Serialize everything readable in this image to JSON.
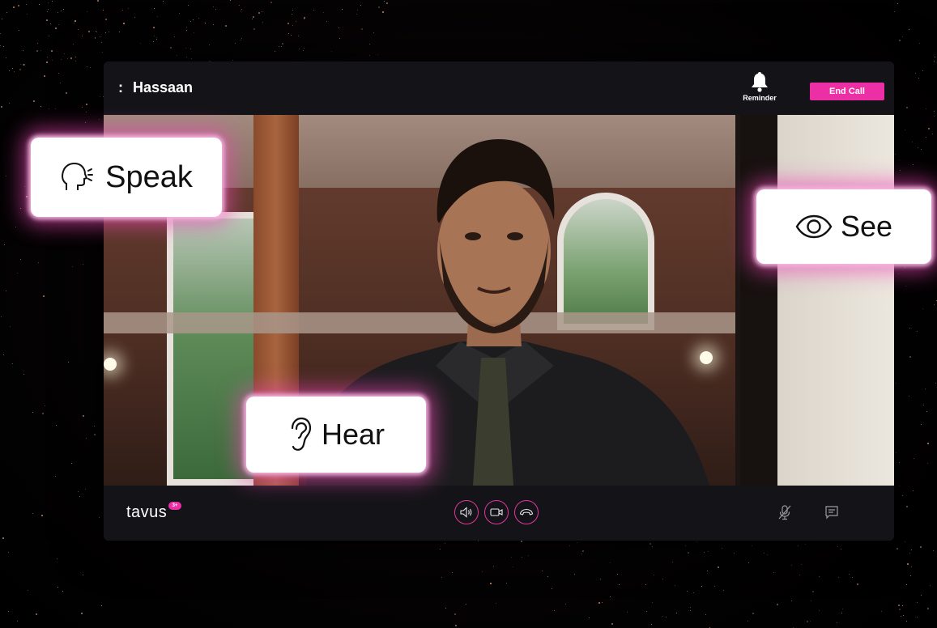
{
  "header": {
    "separator": ":",
    "caller_name": "Hassaan",
    "reminder_label": "Reminder",
    "end_call_label": "End Call"
  },
  "captions": {
    "speak": "Speak",
    "see": "See",
    "hear": "Hear"
  },
  "footer": {
    "brand": "tavus",
    "brand_badge": "3+"
  },
  "icons": {
    "reminder": "bell-icon",
    "speak": "speaking-head-icon",
    "see": "eye-icon",
    "hear": "ear-icon",
    "speaker": "speaker-icon",
    "camera": "camera-icon",
    "hangup": "phone-hangup-icon",
    "mute": "mic-off-icon",
    "chat": "chat-icon"
  },
  "colors": {
    "accent": "#ec2fa4",
    "panel": "#141418",
    "glow": "#f4b8e2"
  }
}
